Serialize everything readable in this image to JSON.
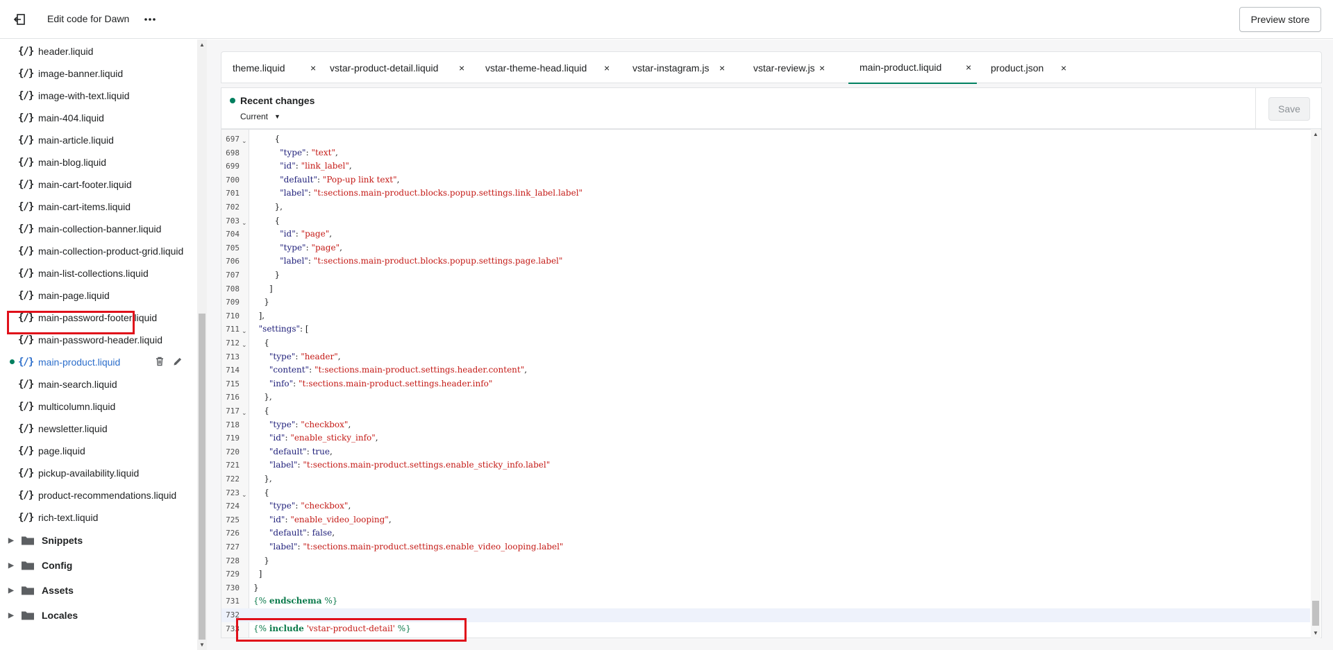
{
  "header": {
    "title": "Edit code for Dawn",
    "preview_label": "Preview store"
  },
  "sidebar": {
    "files": [
      {
        "icon": "{/}",
        "name": "header.liquid"
      },
      {
        "icon": "{/}",
        "name": "image-banner.liquid"
      },
      {
        "icon": "{/}",
        "name": "image-with-text.liquid"
      },
      {
        "icon": "{/}",
        "name": "main-404.liquid"
      },
      {
        "icon": "{/}",
        "name": "main-article.liquid"
      },
      {
        "icon": "{/}",
        "name": "main-blog.liquid"
      },
      {
        "icon": "{/}",
        "name": "main-cart-footer.liquid"
      },
      {
        "icon": "{/}",
        "name": "main-cart-items.liquid"
      },
      {
        "icon": "{/}",
        "name": "main-collection-banner.liquid"
      },
      {
        "icon": "{/}",
        "name": "main-collection-product-grid.liquid"
      },
      {
        "icon": "{/}",
        "name": "main-list-collections.liquid"
      },
      {
        "icon": "{/}",
        "name": "main-page.liquid"
      },
      {
        "icon": "{/}",
        "name": "main-password-footer.liquid"
      },
      {
        "icon": "{/}",
        "name": "main-password-header.liquid"
      },
      {
        "icon": "{/}",
        "name": "main-product.liquid"
      },
      {
        "icon": "{/}",
        "name": "main-search.liquid"
      },
      {
        "icon": "{/}",
        "name": "multicolumn.liquid"
      },
      {
        "icon": "{/}",
        "name": "newsletter.liquid"
      },
      {
        "icon": "{/}",
        "name": "page.liquid"
      },
      {
        "icon": "{/}",
        "name": "pickup-availability.liquid"
      },
      {
        "icon": "{/}",
        "name": "product-recommendations.liquid"
      },
      {
        "icon": "{/}",
        "name": "rich-text.liquid"
      }
    ],
    "folders": [
      {
        "name": "Snippets"
      },
      {
        "name": "Config"
      },
      {
        "name": "Assets"
      },
      {
        "name": "Locales"
      }
    ]
  },
  "tabs": [
    {
      "label": "theme.liquid",
      "close": "×"
    },
    {
      "label": "vstar-product-detail.liquid",
      "close": "×"
    },
    {
      "label": "vstar-theme-head.liquid",
      "close": "×"
    },
    {
      "label": "vstar-instagram.js",
      "close": "×"
    },
    {
      "label": "vstar-review.js",
      "close": "×"
    },
    {
      "label": "main-product.liquid",
      "close": "×"
    },
    {
      "label": "product.json",
      "close": "×"
    }
  ],
  "recent": {
    "label": "Recent changes",
    "version": "Current",
    "save_label": "Save"
  },
  "editor": {
    "lines": [
      {
        "n": "697",
        "fold": "⌄"
      },
      {
        "n": "698",
        "fold": ""
      },
      {
        "n": "699",
        "fold": ""
      },
      {
        "n": "700",
        "fold": ""
      },
      {
        "n": "701",
        "fold": ""
      },
      {
        "n": "702",
        "fold": ""
      },
      {
        "n": "703",
        "fold": "⌄"
      },
      {
        "n": "704",
        "fold": ""
      },
      {
        "n": "705",
        "fold": ""
      },
      {
        "n": "706",
        "fold": ""
      },
      {
        "n": "707",
        "fold": ""
      },
      {
        "n": "708",
        "fold": ""
      },
      {
        "n": "709",
        "fold": ""
      },
      {
        "n": "710",
        "fold": ""
      },
      {
        "n": "711",
        "fold": "⌄"
      },
      {
        "n": "712",
        "fold": "⌄"
      },
      {
        "n": "713",
        "fold": ""
      },
      {
        "n": "714",
        "fold": ""
      },
      {
        "n": "715",
        "fold": ""
      },
      {
        "n": "716",
        "fold": ""
      },
      {
        "n": "717",
        "fold": "⌄"
      },
      {
        "n": "718",
        "fold": ""
      },
      {
        "n": "719",
        "fold": ""
      },
      {
        "n": "720",
        "fold": ""
      },
      {
        "n": "721",
        "fold": ""
      },
      {
        "n": "722",
        "fold": ""
      },
      {
        "n": "723",
        "fold": "⌄"
      },
      {
        "n": "724",
        "fold": ""
      },
      {
        "n": "725",
        "fold": ""
      },
      {
        "n": "726",
        "fold": ""
      },
      {
        "n": "727",
        "fold": ""
      },
      {
        "n": "728",
        "fold": ""
      },
      {
        "n": "729",
        "fold": ""
      },
      {
        "n": "730",
        "fold": ""
      },
      {
        "n": "731",
        "fold": ""
      },
      {
        "n": "732",
        "fold": ""
      },
      {
        "n": "733",
        "fold": ""
      }
    ],
    "tokens": [
      [
        [
          "p",
          "        {"
        ]
      ],
      [
        [
          "p",
          "          "
        ],
        [
          "k",
          "\"type\""
        ],
        [
          "p",
          ": "
        ],
        [
          "s",
          "\"text\""
        ],
        [
          "p",
          ","
        ]
      ],
      [
        [
          "p",
          "          "
        ],
        [
          "k",
          "\"id\""
        ],
        [
          "p",
          ": "
        ],
        [
          "s",
          "\"link_label\""
        ],
        [
          "p",
          ","
        ]
      ],
      [
        [
          "p",
          "          "
        ],
        [
          "k",
          "\"default\""
        ],
        [
          "p",
          ": "
        ],
        [
          "s",
          "\"Pop-up link text\""
        ],
        [
          "p",
          ","
        ]
      ],
      [
        [
          "p",
          "          "
        ],
        [
          "k",
          "\"label\""
        ],
        [
          "p",
          ": "
        ],
        [
          "s",
          "\"t:sections.main-product.blocks.popup.settings.link_label.label\""
        ]
      ],
      [
        [
          "p",
          "        },"
        ]
      ],
      [
        [
          "p",
          "        {"
        ]
      ],
      [
        [
          "p",
          "          "
        ],
        [
          "k",
          "\"id\""
        ],
        [
          "p",
          ": "
        ],
        [
          "s",
          "\"page\""
        ],
        [
          "p",
          ","
        ]
      ],
      [
        [
          "p",
          "          "
        ],
        [
          "k",
          "\"type\""
        ],
        [
          "p",
          ": "
        ],
        [
          "s",
          "\"page\""
        ],
        [
          "p",
          ","
        ]
      ],
      [
        [
          "p",
          "          "
        ],
        [
          "k",
          "\"label\""
        ],
        [
          "p",
          ": "
        ],
        [
          "s",
          "\"t:sections.main-product.blocks.popup.settings.page.label\""
        ]
      ],
      [
        [
          "p",
          "        }"
        ]
      ],
      [
        [
          "p",
          "      ]"
        ]
      ],
      [
        [
          "p",
          "    }"
        ]
      ],
      [
        [
          "p",
          "  ],"
        ]
      ],
      [
        [
          "p",
          "  "
        ],
        [
          "k",
          "\"settings\""
        ],
        [
          "p",
          ": ["
        ]
      ],
      [
        [
          "p",
          "    {"
        ]
      ],
      [
        [
          "p",
          "      "
        ],
        [
          "k",
          "\"type\""
        ],
        [
          "p",
          ": "
        ],
        [
          "s",
          "\"header\""
        ],
        [
          "p",
          ","
        ]
      ],
      [
        [
          "p",
          "      "
        ],
        [
          "k",
          "\"content\""
        ],
        [
          "p",
          ": "
        ],
        [
          "s",
          "\"t:sections.main-product.settings.header.content\""
        ],
        [
          "p",
          ","
        ]
      ],
      [
        [
          "p",
          "      "
        ],
        [
          "k",
          "\"info\""
        ],
        [
          "p",
          ": "
        ],
        [
          "s",
          "\"t:sections.main-product.settings.header.info\""
        ]
      ],
      [
        [
          "p",
          "    },"
        ]
      ],
      [
        [
          "p",
          "    {"
        ]
      ],
      [
        [
          "p",
          "      "
        ],
        [
          "k",
          "\"type\""
        ],
        [
          "p",
          ": "
        ],
        [
          "s",
          "\"checkbox\""
        ],
        [
          "p",
          ","
        ]
      ],
      [
        [
          "p",
          "      "
        ],
        [
          "k",
          "\"id\""
        ],
        [
          "p",
          ": "
        ],
        [
          "s",
          "\"enable_sticky_info\""
        ],
        [
          "p",
          ","
        ]
      ],
      [
        [
          "p",
          "      "
        ],
        [
          "k",
          "\"default\""
        ],
        [
          "p",
          ": "
        ],
        [
          "b",
          "true"
        ],
        [
          "p",
          ","
        ]
      ],
      [
        [
          "p",
          "      "
        ],
        [
          "k",
          "\"label\""
        ],
        [
          "p",
          ": "
        ],
        [
          "s",
          "\"t:sections.main-product.settings.enable_sticky_info.label\""
        ]
      ],
      [
        [
          "p",
          "    },"
        ]
      ],
      [
        [
          "p",
          "    {"
        ]
      ],
      [
        [
          "p",
          "      "
        ],
        [
          "k",
          "\"type\""
        ],
        [
          "p",
          ": "
        ],
        [
          "s",
          "\"checkbox\""
        ],
        [
          "p",
          ","
        ]
      ],
      [
        [
          "p",
          "      "
        ],
        [
          "k",
          "\"id\""
        ],
        [
          "p",
          ": "
        ],
        [
          "s",
          "\"enable_video_looping\""
        ],
        [
          "p",
          ","
        ]
      ],
      [
        [
          "p",
          "      "
        ],
        [
          "k",
          "\"default\""
        ],
        [
          "p",
          ": "
        ],
        [
          "b",
          "false"
        ],
        [
          "p",
          ","
        ]
      ],
      [
        [
          "p",
          "      "
        ],
        [
          "k",
          "\"label\""
        ],
        [
          "p",
          ": "
        ],
        [
          "s",
          "\"t:sections.main-product.settings.enable_video_looping.label\""
        ]
      ],
      [
        [
          "p",
          "    }"
        ]
      ],
      [
        [
          "p",
          "  ]"
        ]
      ],
      [
        [
          "p",
          "}"
        ]
      ],
      [
        [
          "t",
          "{% "
        ],
        [
          "w",
          "endschema"
        ],
        [
          "t",
          " %}"
        ]
      ],
      [
        [
          "p",
          ""
        ]
      ],
      [
        [
          "t",
          "{% "
        ],
        [
          "w",
          "include"
        ],
        [
          "p",
          " "
        ],
        [
          "s",
          "'vstar-product-detail'"
        ],
        [
          "t",
          " %}"
        ]
      ]
    ]
  },
  "colors": {
    "accent_green": "#007f5f",
    "active_link": "#2c6ecb",
    "highlight_red": "#e0101a"
  },
  "icons": {
    "back": "exit-icon",
    "more": "more-horizontal-icon",
    "delete": "trash-icon",
    "rename": "pencil-icon",
    "folder": "folder-icon"
  }
}
